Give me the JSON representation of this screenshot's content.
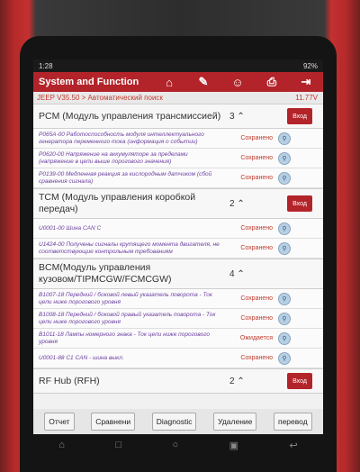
{
  "status": {
    "time": "1:28",
    "battery": "92%"
  },
  "header": {
    "title": "System and Function"
  },
  "crumb": {
    "path": "JEEP V35.50 > Автоматический поиск",
    "voltage": "11.77V"
  },
  "enter_label": "Вход",
  "modules": [
    {
      "name": "PCM (Модуль управления трансмиссией)",
      "count": "3",
      "codes": [
        {
          "desc": "P065A-00 Работоспособность модуля интеллектуального генератора переменного тока (информация о событии)",
          "status": "Сохранено"
        },
        {
          "desc": "P0620-00 Напряжение на аккумуляторе за пределами (напряжение в цепи выше порогового значения)",
          "status": "Сохранено"
        },
        {
          "desc": "P0139-00 Медленная реакция за кислородным датчиком (сбой сравнения сигнала)",
          "status": "Сохранено"
        }
      ]
    },
    {
      "name": "TCM (Модуль управления коробкой передач)",
      "count": "2",
      "codes": [
        {
          "desc": "U0001-00 Шина CAN C",
          "status": "Сохранено"
        },
        {
          "desc": "U1424-00 Получены сигналы крутящего момента двигателя, не соответствующие контрольным требованиям",
          "status": "Сохранено"
        }
      ]
    },
    {
      "name": "BCM(Модуль управления кузовом/TIPMCGW/FCMCGW)",
      "count": "4",
      "codes": [
        {
          "desc": "B1007-18 Передний / боковой левый указатель поворота - Ток цепи ниже порогового уровня",
          "status": "Сохранено"
        },
        {
          "desc": "B1008-18 Передний / боковой правый указатель поворота - Ток цепи ниже порогового уровня",
          "status": "Сохранено"
        },
        {
          "desc": "B1011-18 Лампы номерного знака - Ток цепи ниже порогового уровня",
          "status": "Ожидается"
        },
        {
          "desc": "U0001-88 C1 CAN - шина выкл.",
          "status": "Сохранено"
        }
      ]
    },
    {
      "name": "RF Hub (RFH)",
      "count": "2",
      "codes": []
    }
  ],
  "buttons": {
    "report": "Отчет",
    "compare": "Сравнени",
    "diagnostic": "Diagnostic",
    "delete": "Удаление",
    "translate": "перевод"
  }
}
